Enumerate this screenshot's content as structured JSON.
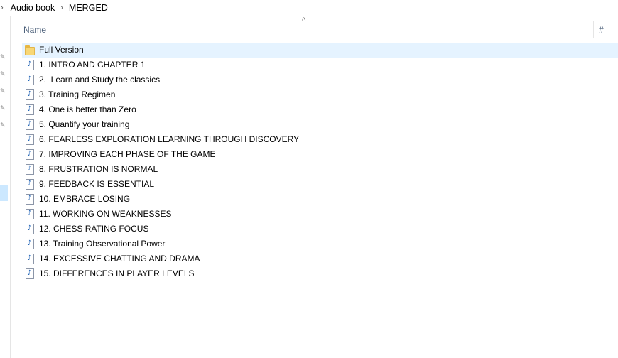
{
  "breadcrumb": {
    "items": [
      "Audio book",
      "MERGED"
    ]
  },
  "header": {
    "name_column": "Name",
    "number_column": "#",
    "sort_indicator": "^"
  },
  "files": [
    {
      "name": "Full Version",
      "type": "folder",
      "selected": true
    },
    {
      "name": "1. INTRO AND CHAPTER 1",
      "type": "audio"
    },
    {
      "name": "2.  Learn and Study the classics",
      "type": "audio"
    },
    {
      "name": "3. Training Regimen",
      "type": "audio"
    },
    {
      "name": "4. One is better than Zero",
      "type": "audio"
    },
    {
      "name": "5. Quantify your training",
      "type": "audio"
    },
    {
      "name": "6. FEARLESS EXPLORATION LEARNING THROUGH DISCOVERY",
      "type": "audio"
    },
    {
      "name": "7. IMPROVING EACH PHASE OF THE GAME",
      "type": "audio"
    },
    {
      "name": "8. FRUSTRATION IS NORMAL",
      "type": "audio"
    },
    {
      "name": "9. FEEDBACK IS ESSENTIAL",
      "type": "audio"
    },
    {
      "name": "10. EMBRACE LOSING",
      "type": "audio"
    },
    {
      "name": "11. WORKING ON WEAKNESSES",
      "type": "audio"
    },
    {
      "name": "12. CHESS RATING FOCUS",
      "type": "audio"
    },
    {
      "name": "13. Training Observational Power",
      "type": "audio"
    },
    {
      "name": "14. EXCESSIVE CHATTING AND DRAMA",
      "type": "audio"
    },
    {
      "name": "15. DIFFERENCES IN PLAYER LEVELS",
      "type": "audio"
    }
  ],
  "icons": {
    "folder": "folder-icon",
    "audio": "audio-file-icon",
    "pin": "pin-icon"
  },
  "colors": {
    "selected_row": "#e5f3ff",
    "nav_selected": "#cce8ff",
    "header_text": "#4c607a"
  }
}
